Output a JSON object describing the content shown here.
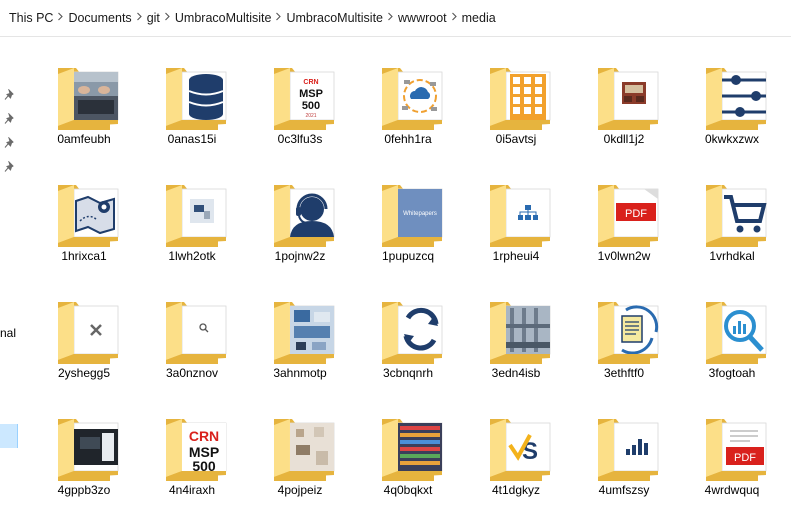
{
  "breadcrumb": [
    "This PC",
    "Documents",
    "git",
    "UmbracoMultisite",
    "UmbracoMultisite",
    "wwwroot",
    "media"
  ],
  "nav": {
    "partial_label": "nal"
  },
  "folders": [
    {
      "name": "0amfeubh",
      "thumb": "laptop"
    },
    {
      "name": "0anas15i",
      "thumb": "database"
    },
    {
      "name": "0c3lfu3s",
      "thumb": "crn2021"
    },
    {
      "name": "0fehh1ra",
      "thumb": "cloud-cycle"
    },
    {
      "name": "0i5avtsj",
      "thumb": "building"
    },
    {
      "name": "0kdll1j2",
      "thumb": "interior"
    },
    {
      "name": "0kwkxzwx",
      "thumb": "sliders"
    },
    {
      "name": "1hrixca1",
      "thumb": "map"
    },
    {
      "name": "1lwh2otk",
      "thumb": "desk"
    },
    {
      "name": "1pojnw2z",
      "thumb": "headset"
    },
    {
      "name": "1pupuzcq",
      "thumb": "whitepapers"
    },
    {
      "name": "1rpheui4",
      "thumb": "org"
    },
    {
      "name": "1v0lwn2w",
      "thumb": "pdf"
    },
    {
      "name": "1vrhdkal",
      "thumb": "cart"
    },
    {
      "name": "2yshegg5",
      "thumb": "tools"
    },
    {
      "name": "3a0nznov",
      "thumb": "search-small"
    },
    {
      "name": "3ahnmotp",
      "thumb": "tech-collage"
    },
    {
      "name": "3cbnqnrh",
      "thumb": "refresh"
    },
    {
      "name": "3edn4isb",
      "thumb": "pipes"
    },
    {
      "name": "3ethftf0",
      "thumb": "doc-cycle"
    },
    {
      "name": "3fogtoah",
      "thumb": "magnifier-chart"
    },
    {
      "name": "4gppb3zo",
      "thumb": "dark-photo"
    },
    {
      "name": "4n4iraxh",
      "thumb": "crn"
    },
    {
      "name": "4pojpeiz",
      "thumb": "workspace"
    },
    {
      "name": "4q0bqkxt",
      "thumb": "server"
    },
    {
      "name": "4t1dgkyz",
      "thumb": "check-s"
    },
    {
      "name": "4umfszsy",
      "thumb": "bars"
    },
    {
      "name": "4wrdwquq",
      "thumb": "pdf2"
    }
  ],
  "thumb_text": {
    "crn": "CRN",
    "msp": "MSP",
    "msp_number": "500",
    "crn_year": "2021",
    "whitepapers": "Whitepapers",
    "pdf": "PDF"
  },
  "colors": {
    "folder_back": "#e6b43e",
    "folder_front": "#fde28c",
    "icon_navy": "#1f3d6b",
    "icon_blue": "#2a6bb0",
    "building_orange": "#f2a12c",
    "pdf_red": "#d9211c",
    "selection": "#cce8ff"
  }
}
